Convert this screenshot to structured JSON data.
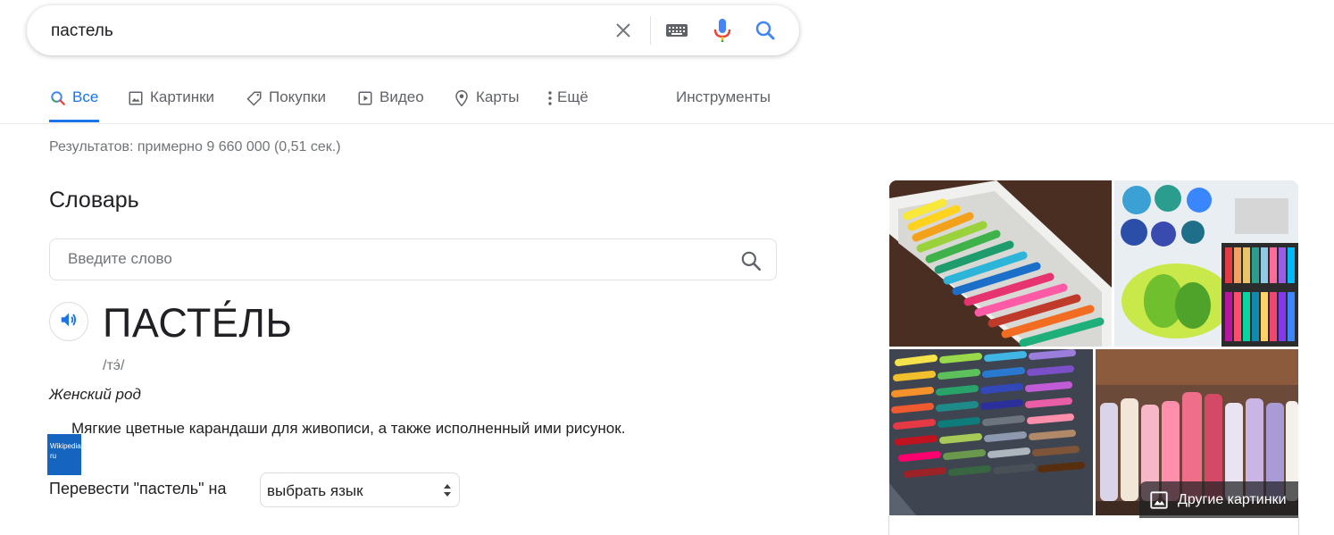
{
  "search": {
    "query": "пастель",
    "icons": [
      "close-icon",
      "keyboard-icon",
      "microphone-icon",
      "search-icon"
    ]
  },
  "tabs": [
    {
      "label": "Все",
      "icon": "search-icon",
      "active": true
    },
    {
      "label": "Картинки",
      "icon": "image-icon"
    },
    {
      "label": "Покупки",
      "icon": "tag-icon"
    },
    {
      "label": "Видео",
      "icon": "video-icon"
    },
    {
      "label": "Карты",
      "icon": "map-pin-icon"
    },
    {
      "label": "Ещё",
      "icon": "more-icon"
    }
  ],
  "tools_label": "Инструменты",
  "result_stats": "Результатов: примерно 9 660 000 (0,51 сек.)",
  "dictionary": {
    "title": "Словарь",
    "input_placeholder": "Введите слово",
    "headword": "ПАСТЕ́ЛЬ",
    "phonetic": "/тэ́/",
    "part_of_speech": "Женский род",
    "definition": "Мягкие цветные карандаши для живописи, а также исполненный ими рисунок.",
    "badge_text": "Wikipedia ru",
    "translate_label": "Перевести \"пастель\" на",
    "language_select": "выбрать язык"
  },
  "images": {
    "more_label": "Другие картинки",
    "colors": {
      "accent": "#1a73e8",
      "text": "#202124",
      "muted": "#70757a"
    }
  }
}
